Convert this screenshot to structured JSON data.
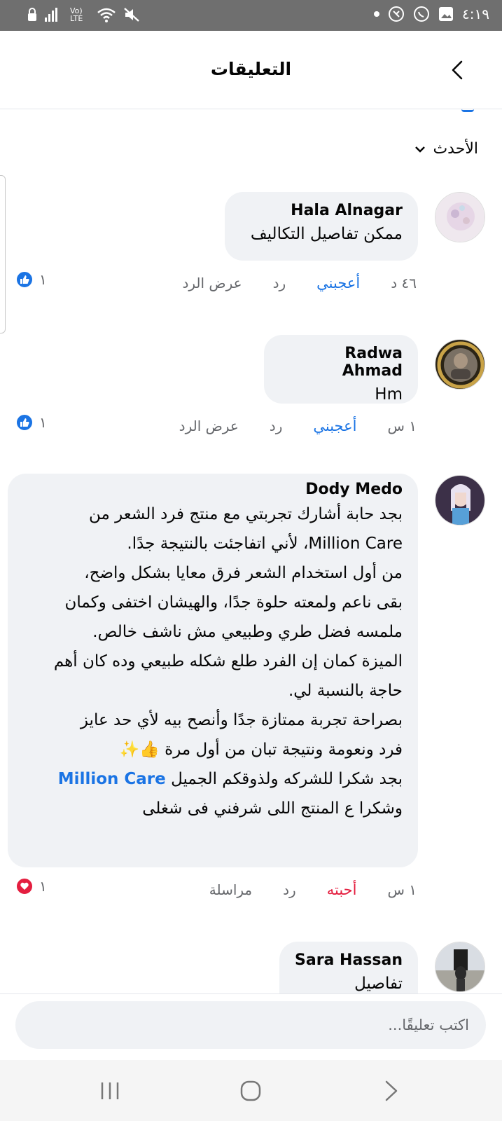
{
  "status_bar": {
    "time": "٤:١٩",
    "network": "Vo) LTE"
  },
  "header": {
    "title": "التعليقات"
  },
  "sort": {
    "label": "الأحدث"
  },
  "comments": [
    {
      "author": "Hala Alnagar",
      "text": "ممكن تفاصيل التكاليف",
      "time": "٤٦ د",
      "like_label": "أعجبني",
      "reply_label": "رد",
      "view_replies": "عرض الرد",
      "reaction_count": "١",
      "reaction": "like"
    },
    {
      "author": "Radwa Ahmad",
      "text": "Hm",
      "time": "١ س",
      "like_label": "أعجبني",
      "reply_label": "رد",
      "view_replies": "عرض الرد",
      "reaction_count": "١",
      "reaction": "like"
    },
    {
      "author": "Dody Medo",
      "lines": [
        "بجد حابة أشارك تجربتي مع منتج فرد الشعر من",
        "Million Care، لأني اتفاجئت بالنتيجة جدًا.",
        "من أول استخدام الشعر فرق معايا بشكل واضح،",
        "بقى ناعم ولمعته حلوة جدًا، والهيشان اختفى  وكمان",
        "ملمسه فضل طري وطبيعي مش ناشف خالص.",
        "الميزة كمان إن الفرد طلع شكله طبيعي وده كان أهم",
        "حاجة بالنسبة لي.",
        "بصراحة تجربة ممتازة جدًا وأنصح بيه لأي حد عايز",
        "فرد ونعومة ونتيجة تبان من أول مرة 👍✨"
      ],
      "thanks_text": "بجد شكرا للشركه ولذوقكم الجميل",
      "brand_tag": "Million Care",
      "last_line": "وشكرا ع المنتج اللى شرفني فى شغلى",
      "time": "١ س",
      "like_label": "أحبته",
      "reply_label": "رد",
      "message_label": "مراسلة",
      "reaction_count": "١",
      "reaction": "love"
    },
    {
      "author": "Sara Hassan",
      "text": "تفاصيل"
    }
  ],
  "composer": {
    "placeholder": "اكتب تعليقًا..."
  },
  "colors": {
    "accent": "#1b74e4",
    "love": "#e41e3f",
    "bubble": "#f0f2f5"
  }
}
